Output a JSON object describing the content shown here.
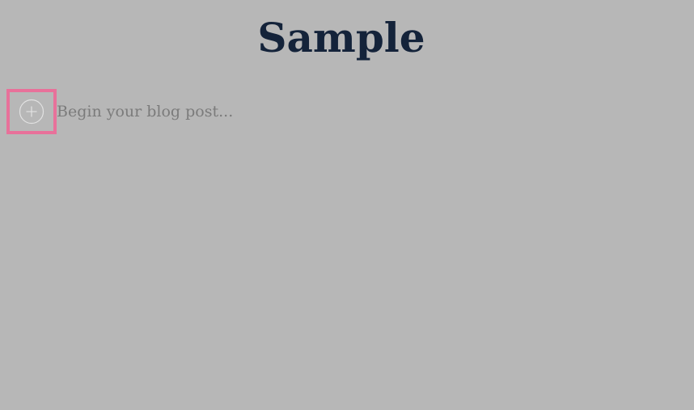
{
  "post": {
    "title": "Sample",
    "body_placeholder": "Begin your blog post..."
  },
  "inserter": {
    "icon": "plus-circle-icon"
  },
  "colors": {
    "background": "#b7b7b7",
    "title": "#14233a",
    "placeholder": "#7b7b7b",
    "highlight": "#e8719a"
  }
}
